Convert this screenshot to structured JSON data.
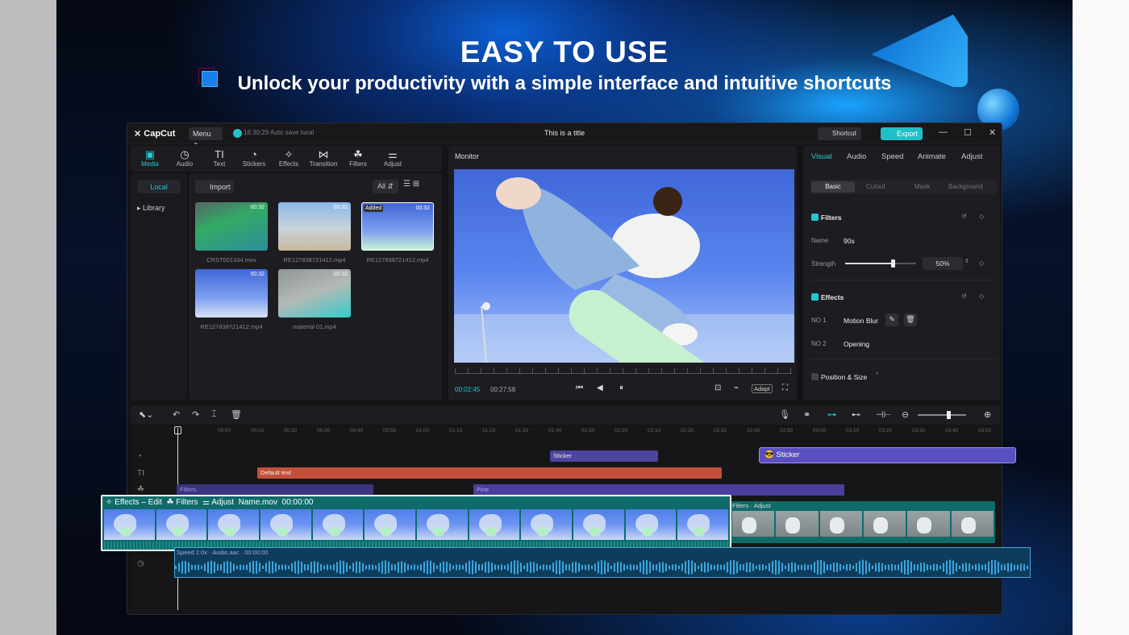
{
  "hero": {
    "headline": "EASY TO USE",
    "subheadline": "Unlock your productivity with a simple interface and intuitive shortcuts"
  },
  "titlebar": {
    "logo": "CapCut",
    "menu": "Menu",
    "autosave": "16:30:29 Auto save local",
    "title": "This is a title",
    "shortcut": "Shortcut",
    "export": "Export"
  },
  "toolbar_tabs": [
    {
      "label": "Media",
      "icon": "media-icon",
      "glyph": "▣"
    },
    {
      "label": "Audio",
      "icon": "audio-icon",
      "glyph": "◷"
    },
    {
      "label": "Text",
      "icon": "text-icon",
      "glyph": "TI"
    },
    {
      "label": "Stickers",
      "icon": "stickers-icon",
      "glyph": "◔"
    },
    {
      "label": "Effects",
      "icon": "effects-icon",
      "glyph": "✧"
    },
    {
      "label": "Transition",
      "icon": "transition-icon",
      "glyph": "⋈"
    },
    {
      "label": "Filters",
      "icon": "filters-icon",
      "glyph": "☘"
    },
    {
      "label": "Adjust",
      "icon": "adjust-icon",
      "glyph": "⚌"
    }
  ],
  "sidebar": {
    "local": "Local",
    "library": "Library"
  },
  "media": {
    "import": "Import",
    "filter": "All",
    "items": [
      {
        "duration": "00:32",
        "name": "CRST001334.mov",
        "added": ""
      },
      {
        "duration": "00:32",
        "name": "RE127838721412.mp4",
        "added": ""
      },
      {
        "duration": "00:32",
        "name": "RE127838721412.mp4",
        "added": "Added"
      },
      {
        "duration": "00:32",
        "name": "RE127838721412.mp4",
        "added": ""
      },
      {
        "duration": "00:32",
        "name": "material 01.mp4",
        "added": ""
      }
    ]
  },
  "monitor": {
    "label": "Monitor",
    "current_time": "00:02:45",
    "total_time": "00:27:58",
    "adapt": "Adapt"
  },
  "properties": {
    "tabs": [
      "Visual",
      "Audio",
      "Speed",
      "Animate",
      "Adjust"
    ],
    "subtabs": [
      "Basic",
      "Cutout",
      "Mask",
      "Background"
    ],
    "filters": {
      "label": "Filters",
      "name_label": "Name",
      "name_value": "90s",
      "strength_label": "Strength",
      "strength_value": "50%",
      "strength_fraction": 0.5
    },
    "effects": {
      "label": "Effects",
      "no1_label": "NO 1",
      "no1_value": "Motion Blur",
      "no2_label": "NO 2",
      "no2_value": "Opening"
    },
    "position_size": "Position & Size"
  },
  "ruler_ticks": [
    "00:00",
    "00:10",
    "00:20",
    "00:30",
    "00:40",
    "00:50",
    "01:00",
    "01:10",
    "01:20",
    "01:30",
    "01:40",
    "01:50",
    "02:00",
    "02:10",
    "02:20",
    "02:30",
    "02:40",
    "02:50",
    "03:00",
    "03:10",
    "03:20",
    "03:30",
    "03:40",
    "03:50"
  ],
  "timeline": {
    "sticker_1": "Sticker",
    "sticker_2": "Sticker",
    "default_text": "Default text",
    "filters_clip": "Filters",
    "pine_clip": "Pine",
    "popout": {
      "effects": "Effects – Edit",
      "filters": "Filters",
      "adjust": "Adjust",
      "name": "Name.mov",
      "time": "00:00:00"
    },
    "ext_filters": "Filters",
    "ext_adjust": "Adjust",
    "audio_speed": "Speed 2.0x",
    "audio_name": "Audio.aac",
    "audio_time": "00:00:00"
  }
}
